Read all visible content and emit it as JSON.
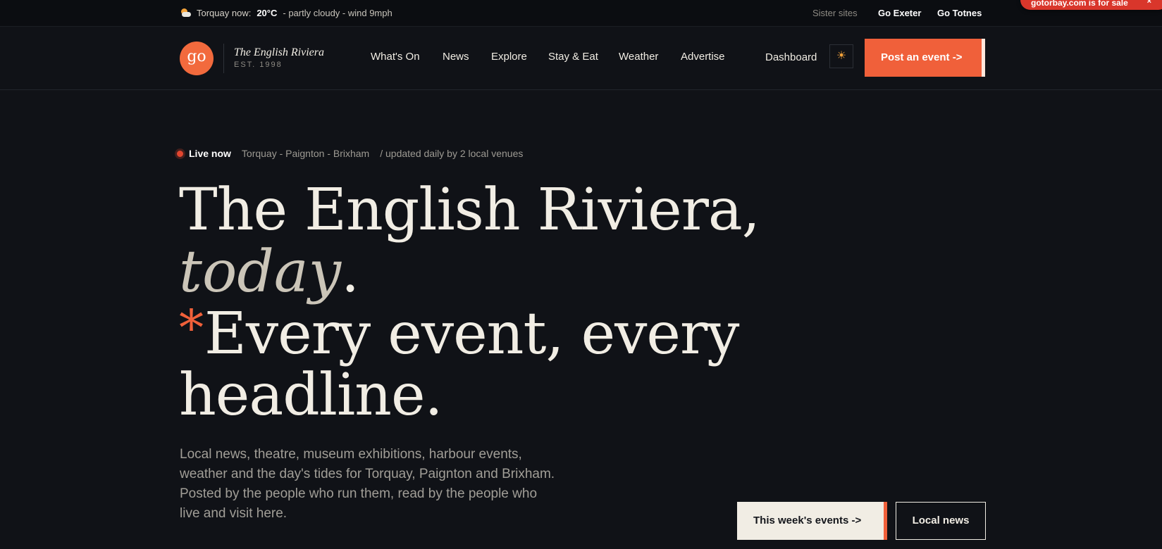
{
  "topbar": {
    "weather_label": "Torquay now:",
    "temperature": "20°C",
    "conditions": "- partly cloudy - wind 9mph",
    "sister_label": "Sister sites",
    "sister_links": [
      "Go Exeter",
      "Go Totnes"
    ],
    "sale_badge": "gotorbay.com is for sale",
    "sale_close": "×"
  },
  "header": {
    "logo_text": "go",
    "brand_name": "The English Riviera",
    "brand_est": "EST. 1998",
    "nav": [
      "What's On",
      "News",
      "Explore",
      "Stay & Eat",
      "Weather",
      "Advertise"
    ],
    "dashboard": "Dashboard",
    "theme_icon": "☀",
    "post_button": "Post an event  ->"
  },
  "hero": {
    "live_label": "Live now",
    "towns": "Torquay - Paignton - Brixham",
    "updated": "/ updated daily by 2 local venues",
    "line1": "The English Riviera,",
    "line2_italic": "today",
    "line2_end": ".",
    "asterisk": "*",
    "line3": "Every event, every",
    "line4": "headline.",
    "intro": "Local news, theatre, museum exhibitions, harbour events, weather and the day's tides for Torquay, Paignton and Brixham. Posted by the people who run them, read by the people who live and visit here.",
    "cta_primary": "This week's events  ->",
    "cta_secondary": "Local news"
  },
  "colors": {
    "background": "#101217",
    "accent": "#f0603a",
    "text": "#f1ede4"
  }
}
